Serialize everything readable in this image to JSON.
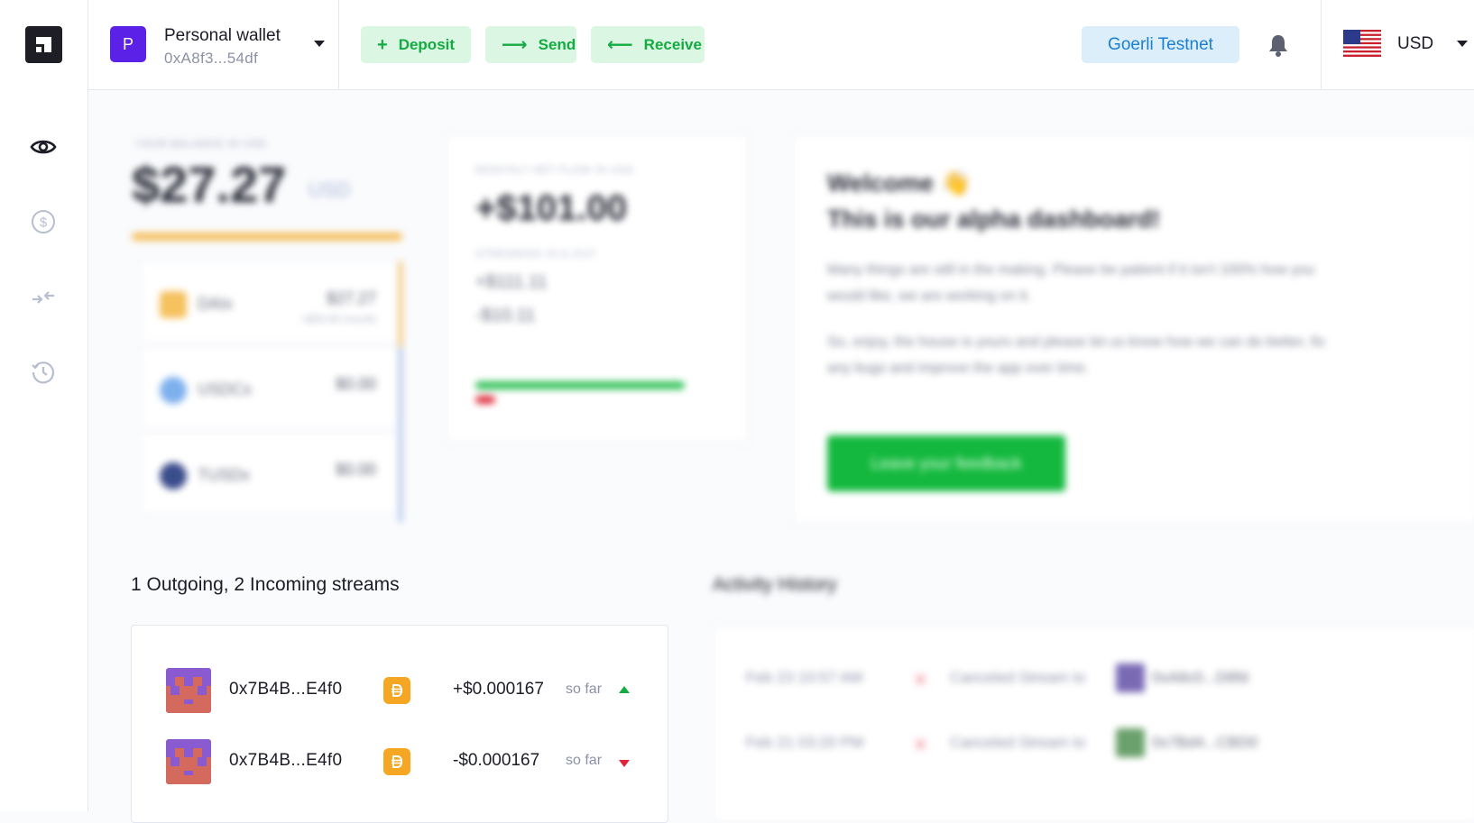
{
  "rail": {
    "icons": [
      "logo-icon",
      "eye-icon",
      "dollar-icon",
      "transfer-icon",
      "history-icon"
    ]
  },
  "wallet": {
    "avatar_letter": "P",
    "name": "Personal wallet",
    "address": "0xA8f3...54df"
  },
  "actions": {
    "deposit": "Deposit",
    "send": "Send",
    "receive": "Receive"
  },
  "network": "Goerli Testnet",
  "currency": "USD",
  "balance": {
    "label": "YOUR BALANCE IN USD",
    "amount": "$27.27",
    "unit": "USD",
    "tokens": [
      {
        "name": "DAIx",
        "value": "$27.27",
        "sub": "+$00.00 /month"
      },
      {
        "name": "USDCx",
        "value": "$0.00"
      },
      {
        "name": "TUSDx",
        "value": "$0.00"
      }
    ]
  },
  "flow": {
    "label": "MONTHLY NET FLOW IN USD",
    "amount": "+$101.00",
    "streams_label": "STREAMING IN & OUT",
    "incoming": "+$111.11",
    "outgoing": "-$10.11"
  },
  "welcome": {
    "title": "Welcome 👋",
    "subtitle": "This is our alpha dashboard!",
    "p1": "Many things are still in the making. Please be patient if it isn't 100% how you would like, we are working on it.",
    "p2": "So, enjoy, the house is yours and please let us know how we can do better, fix any bugs and improve the app over time.",
    "button": "Leave your feedback"
  },
  "streams": {
    "title": "1 Outgoing, 2 Incoming streams",
    "rows": [
      {
        "address": "0x7B4B...E4f0",
        "amount": "+$0.000167",
        "so_far": "so far",
        "direction": "up"
      },
      {
        "address": "0x7B4B...E4f0",
        "amount": "-$0.000167",
        "so_far": "so far",
        "direction": "down"
      }
    ]
  },
  "activity": {
    "title": "Activity History",
    "rows": [
      {
        "date": "Feb 23 10:57 AM",
        "text": "Canceled Stream to",
        "address": "0xA8c0...D8fd"
      },
      {
        "date": "Feb 21 03:20 PM",
        "text": "Canceled Stream to",
        "address": "0x7Bd4...CBD0"
      }
    ]
  },
  "colors": {
    "accent_green": "#15ab42",
    "green_bg": "#dbf6e2",
    "network_blue": "#1b7fd1",
    "network_bg": "#dbeefa",
    "avatar_purple": "#5b21e6",
    "token_orange": "#f5a623"
  }
}
